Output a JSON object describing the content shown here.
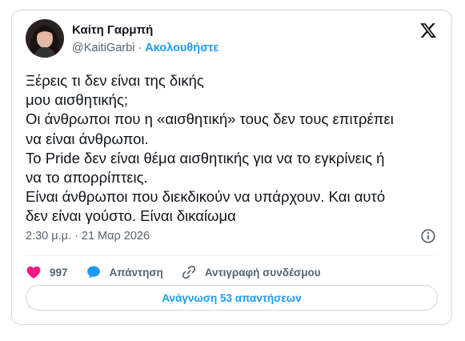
{
  "author": {
    "name": "Καίτη Γαρμπή",
    "handle": "@KaitiGarbi",
    "separator": " · ",
    "follow_label": "Ακολουθήστε"
  },
  "tweet": {
    "lines": [
      "Ξέρεις τι δεν είναι της δικής",
      "μου αισθητικής;",
      "Οι άνθρωποι που η «αισθητική» τους δεν τους επιτρέπει",
      "να είναι άνθρωποι.",
      "Το Pride δεν είναι θέμα αισθητικής για να το εγκρίνεις ή",
      "να το απορρίπτεις.",
      "Είναι άνθρωποι που διεκδικούν να υπάρχουν. Και αυτό",
      "δεν είναι γούστο. Είναι δικαίωμα"
    ],
    "timestamp": "2:30 μ.μ. · 21 Μαρ 2026"
  },
  "actions": {
    "likes_count": "997",
    "reply_label": "Απάντηση",
    "copy_link_label": "Αντιγραφή συνδέσμου"
  },
  "read_replies_label": "Ανάγνωση 53 απαντήσεων",
  "colors": {
    "accent": "#1d9bf0",
    "heart": "#f91880",
    "muted": "#536471",
    "text": "#0f1419",
    "border": "#cfd9de"
  },
  "icons": [
    "x-logo-icon",
    "info-icon",
    "heart-icon",
    "reply-bubble-icon",
    "link-icon"
  ]
}
